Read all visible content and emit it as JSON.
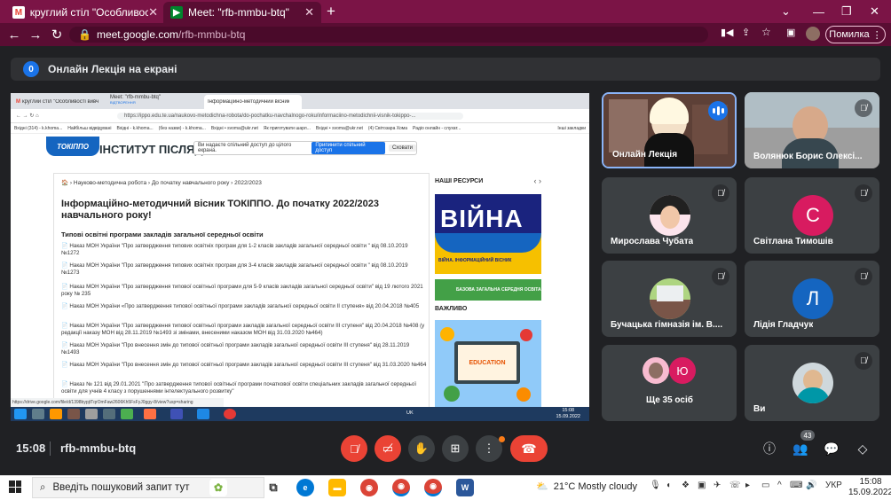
{
  "browser": {
    "tabs": [
      {
        "label": "круглий стіл \"Особливості вивч",
        "icon": "gmail-icon"
      },
      {
        "label": "Meet: \"rfb-mmbu-btq\"",
        "icon": "meet-icon"
      }
    ],
    "new_tab": "+",
    "url_host": "meet.google.com",
    "url_path": "/rfb-mmbu-btq",
    "error_button": "Помилка"
  },
  "meet": {
    "presenting_badge": "0",
    "presenting_title": "Онлайн Лекція на екрані",
    "time": "15:08",
    "meeting_code": "rfb-mmbu-btq",
    "participants_count": "43"
  },
  "shared_screen": {
    "tabs": [
      "круглий стіл \"Особливості вивч",
      "Meet: \"rfb-mmbu-btq\"",
      "Інформаційно-методичний вісник"
    ],
    "meet_tab_sub": "ВІДТВОРЕННЯ",
    "url": "https://ippo.edu.te.ua/naukovo-metodichna-robota/do-pochatku-navchalnogo-roku/informaciino-metodichnii-visnik-tokippo-...",
    "bookmarks": [
      "Вхідні (314) - k.khoma...",
      "Найбільш відвідувані",
      "Вхідні - k.khoma...",
      "(без назви) - k.khoma...",
      "Вхідні • svoma@ukr.net",
      "Як приготувати шарл...",
      "Вхідні • svoma@ukr.net",
      "(4) Світозара Хома",
      "Радіо онлайн - слухат...",
      "Інші закладки"
    ],
    "site_logo": "ТОКІППО",
    "site_title": "ІНСТИТУТ ПІСЛЯД",
    "share_notice": "Ви надаєте спільний доступ до цілого екрана.",
    "share_stop": "Припинити спільний доступ",
    "share_hide": "Сховати",
    "breadcrumb": "🏠 › Науково-методична робота › До початку навчального року › 2022/2023",
    "heading": "Інформаційно-методичний вісник ТОКІППО. До початку 2022/2023 навчального року!",
    "subheading": "Типові освітні програми закладів загальної середньої освіти",
    "orders": [
      "📄 Наказ МОН України \"Про затвердження типових освітніх програм для 1-2 класів закладів загальної середньої освіти \" від 08.10.2019 №1272",
      "📄 Наказ МОН України \"Про затвердження типових освітніх програм для 3-4 класів закладів загальної середньої освіти \" від 08.10.2019 №1273",
      "📄 Наказ МОН України \"Про затвердження типової освітньої програми для 5-9 класів закладів загальної середньої освіти\" від 19 лютого 2021 року № 235",
      "📄 Наказ МОН України «Про затвердження типової освітньої програми закладів загальної середньої освіти ІІ ступеня» від 20.04.2018 №405",
      "📄 Наказ МОН України \"Про затвердження типової освітньої програми закладів загальної середньої освіти ІІІ ступеня\" від 20.04.2018 №408 (у редакції наказу МОН від 28.11.2019 №1493 зі змінами, внесеними наказом МОН від 31.03.2020 №464)",
      "📄 Наказ МОН України \"Про внесення змін до типової освітньої програми закладів загальної середньої освіти ІІІ ступеня\" від 28.11.2019 №1493",
      "📄 Наказ МОН України \"Про внесення змін до типової освітньої програми закладів загальної середньої освіти ІІІ ступеня\" від 31.03.2020 №464",
      "📄 Наказ № 121 від 29.01.2021 \"Про затвердження типової освітньої програми початкової освіти спеціальних закладів загальної середньої освіти для учнів 4 класу з порушеннями інтелектуального розвитку\""
    ],
    "sidebar_title": "НАШІ РЕСУРСИ",
    "war_word": "ВІЙНА",
    "war_sub": "ВІЙНА. ІНФОРМАЦІЙНИЙ ВІСНИК",
    "green_bar": "БАЗОВА ЗАГАЛЬНА СЕРЕДНЯ ОСВІТА",
    "important": "ВАЖЛИВО",
    "edu_word": "EDUCATION",
    "status_url": "https://drive.google.com/file/d/1398bypjtTqrOmFaw2606Kh5FsFyJ0ggy-8/view?usp=sharing",
    "inner_lang": "UK",
    "inner_time": "15:08",
    "inner_date": "15.09.2022"
  },
  "participants": [
    {
      "name": "Онлайн Лекція",
      "state": "speaking"
    },
    {
      "name": "Волянюк Борис Олексі...",
      "state": "muted"
    },
    {
      "name": "Мирослава Чубата",
      "state": "muted"
    },
    {
      "name": "Світлана Тимошів",
      "state": "muted",
      "initial": "С",
      "color": "#d81b60"
    },
    {
      "name": "Бучацька гімназія ім. В....",
      "state": "muted"
    },
    {
      "name": "Лідія Гладчук",
      "state": "muted",
      "initial": "Л",
      "color": "#1565c0"
    },
    {
      "name": "Ще 35 осіб",
      "state": "group",
      "initial": "Ю",
      "color": "#d81b60"
    },
    {
      "name": "Ви",
      "state": "muted"
    }
  ],
  "taskbar": {
    "search_placeholder": "Введіть пошуковий запит тут",
    "weather": "21°C  Mostly cloudy",
    "lang": "УКР",
    "time": "15:08",
    "date": "15.09.2022"
  },
  "colors": {
    "chrome_frame": "#7b1446",
    "meet_bg": "#202124",
    "hangup": "#ea4335",
    "accent": "#1a73e8"
  }
}
